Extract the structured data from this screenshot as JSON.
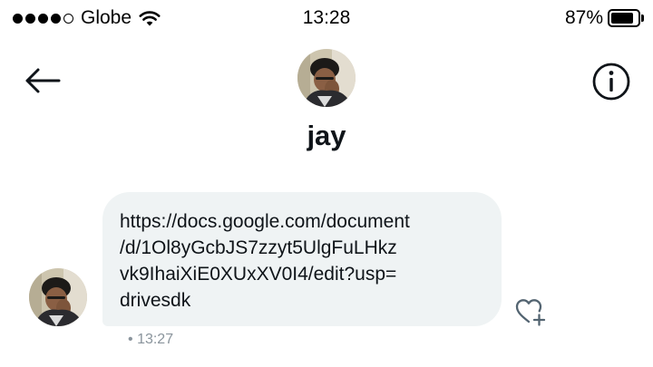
{
  "status_bar": {
    "carrier": "Globe",
    "signal": {
      "filled": 4,
      "total": 5
    },
    "time": "13:28",
    "battery_percent": "87%",
    "battery_level": 0.87,
    "icons": [
      "signal-dots",
      "wifi-icon",
      "battery-icon"
    ]
  },
  "header": {
    "contact_name": "jay",
    "icons": [
      "back-arrow-icon",
      "info-icon",
      "avatar"
    ]
  },
  "message": {
    "lines": [
      "https://docs.google.com/document",
      "/d/1Ol8yGcbJS7zzyt5UlgFuLHkz",
      "vk9IhaiXiE0XUxXV0I4/edit?usp=",
      "drivesdk"
    ],
    "timestamp": "13:27",
    "timestamp_prefix": "•",
    "reaction_icon": "heart-plus-icon"
  },
  "colors": {
    "bubble_background": "#eff3f4",
    "text": "#0f1419",
    "timestamp": "#8a949c"
  }
}
